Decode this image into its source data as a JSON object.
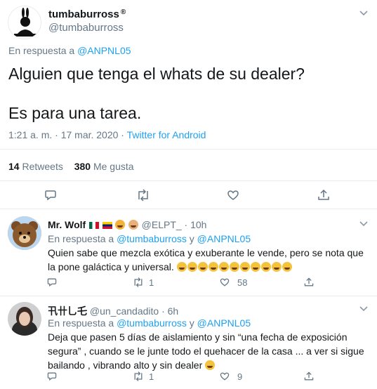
{
  "main_tweet": {
    "display_name": "tumbaburross",
    "badge": "®",
    "handle": "@tumbaburross",
    "avatar_text": "tumbaburross",
    "replying_prefix": "En respuesta a",
    "replying_to": "@ANPNL05",
    "text_line1": "Alguien que tenga el whats de su dealer?",
    "text_line2": "Es para una tarea.",
    "time": "1:21 a. m. · 17 mar. 2020",
    "separator": " · ",
    "source": "Twitter for Android",
    "retweets_count": "14",
    "retweets_label": "Retweets",
    "likes_count": "380",
    "likes_label": "Me gusta"
  },
  "replies": [
    {
      "name": "Mr. Wolf",
      "handle": "@ELPT_",
      "time": "· 10h",
      "replying_prefix": "En respuesta a",
      "replying_to_1": "@tumbaburross",
      "and": " y ",
      "replying_to_2": "@ANPNL05",
      "text": "Quien sabe que mezcla exótica y exuberante le vende, pero se nota que la pone galáctica y universal.",
      "retweets": "1",
      "likes": "58"
    },
    {
      "name": "卂卄乚乇",
      "handle": "@un_candadito",
      "time": "· 6h",
      "replying_prefix": "En respuesta a",
      "replying_to_1": "@tumbaburross",
      "and": " y ",
      "replying_to_2": "@ANPNL05",
      "text": "Deja que pasen 5 días de aislamiento y sin “una fecha de exposición segura” , cuando se le junte todo el quehacer de la casa ... a ver si sigue bailando , vibrando alto y sin dealer",
      "retweets": "1",
      "likes": "9"
    }
  ],
  "icons": {
    "reply": "reply-icon",
    "retweet": "retweet-icon",
    "like": "heart-icon",
    "share": "share-icon",
    "more": "chevron-down-icon"
  },
  "colors": {
    "link": "#1da1f2",
    "secondary_text": "#657786",
    "divider": "#e6ecf0"
  }
}
